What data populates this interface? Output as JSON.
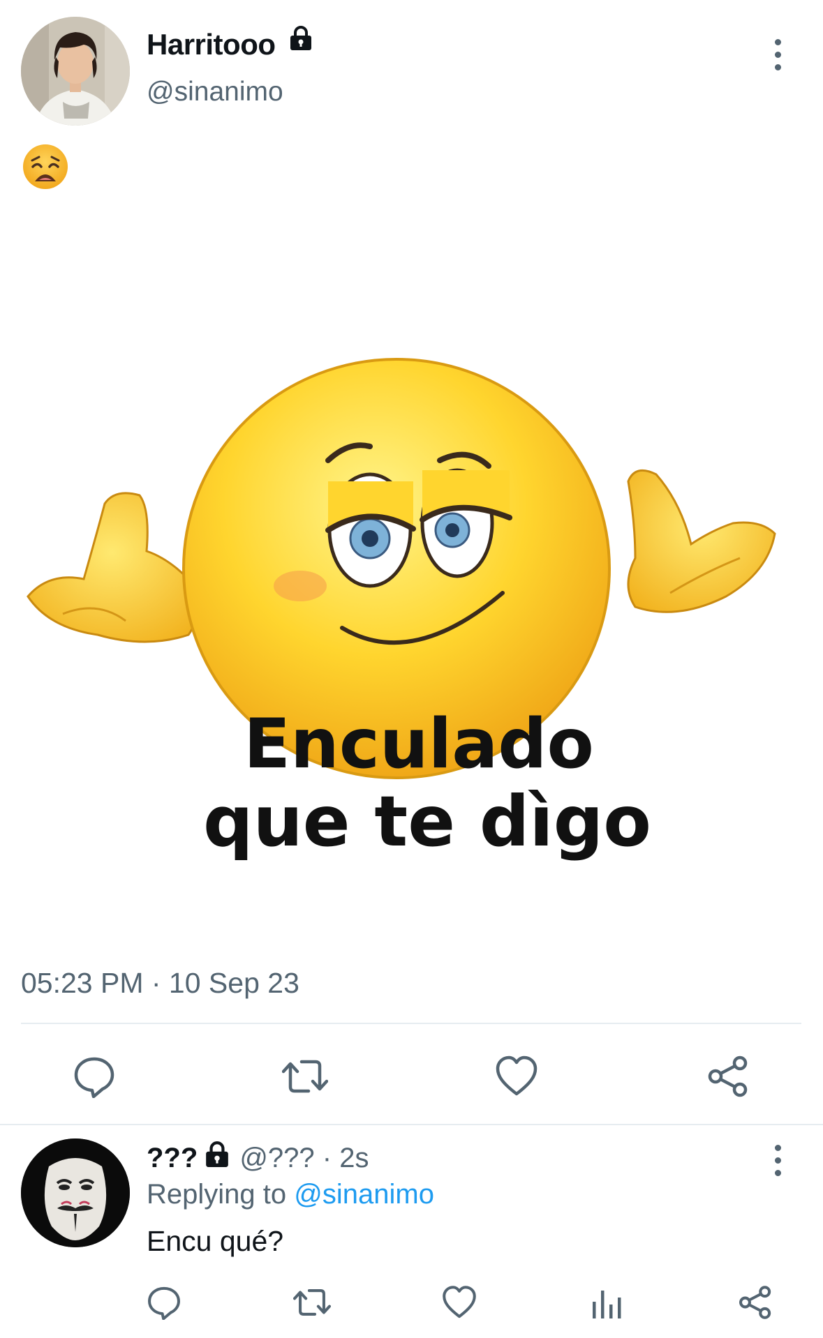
{
  "tweet": {
    "author": {
      "name": "Harritooo",
      "handle": "@sinanimo",
      "protected_icon": "lock-icon"
    },
    "text_emoji": "weary-face-emoji",
    "image": {
      "caption_line_1": "Enculado",
      "caption_line_2": "que te dìgo",
      "depicts": "shrugging-smiling-emoji-meme"
    },
    "timestamp": "05:23 PM · 10 Sep 23",
    "actions": [
      "reply-icon",
      "retweet-icon",
      "like-icon",
      "share-icon"
    ]
  },
  "reply": {
    "author": {
      "name": "???",
      "handle_time": "@??? · 2s",
      "protected_icon": "lock-icon"
    },
    "replying_prefix": "Replying to",
    "replying_handle": "@sinanimo",
    "text": "Encu qué?",
    "actions": [
      "reply-icon",
      "retweet-icon",
      "like-icon",
      "analytics-icon",
      "share-icon"
    ]
  },
  "colors": {
    "secondary_text": "#536471",
    "link": "#1d9bf0",
    "divider": "#e6ecf0",
    "emoji_yellow": "#f7c325"
  }
}
